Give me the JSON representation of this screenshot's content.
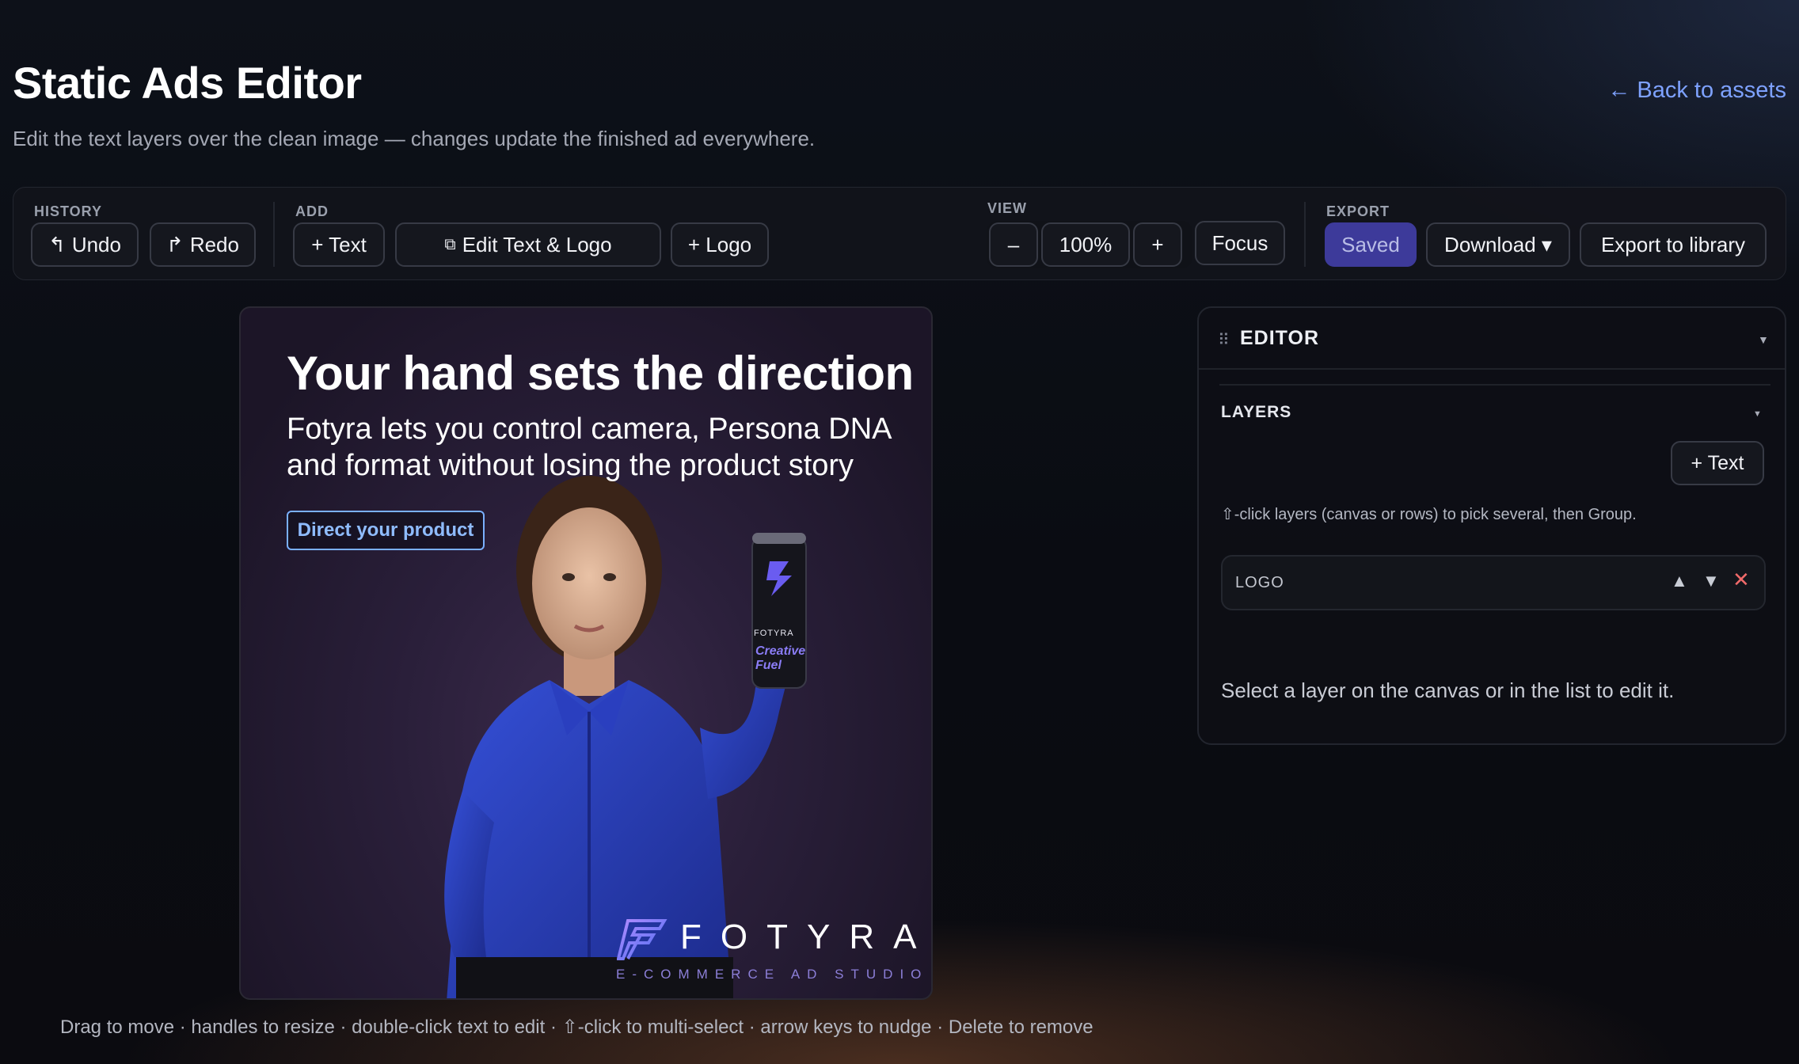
{
  "header": {
    "title": "Static Ads Editor",
    "subtitle": "Edit the text layers over the clean image — changes update the finished ad everywhere.",
    "back_link": "← Back to assets"
  },
  "toolbar": {
    "history": {
      "label": "HISTORY",
      "undo": "Undo",
      "redo": "Redo"
    },
    "add": {
      "label": "ADD",
      "text": "+ Text",
      "edit_text_logo": "Edit Text & Logo",
      "logo": "+ Logo"
    },
    "view": {
      "label": "VIEW",
      "zoom_out": "–",
      "zoom_level": "100%",
      "zoom_in": "+",
      "focus": "Focus"
    },
    "export": {
      "label": "EXPORT",
      "saved": "Saved",
      "download": "Download ▾",
      "export_library": "Export to library"
    }
  },
  "ad": {
    "headline": "Your hand sets the direction",
    "body": "Fotyra lets you control camera, Persona DNA and format without losing the product story",
    "cta": "Direct your product",
    "can_brand": "FOTYRA",
    "can_text": "Creative Fuel",
    "logo_word": "FOTYRA",
    "logo_tagline": "E-COMMERCE AD STUDIO"
  },
  "editor": {
    "title": "EDITOR",
    "layers_title": "LAYERS",
    "add_text": "+ Text",
    "hint": "⇧-click layers (canvas or rows) to pick several, then Group.",
    "layers": [
      {
        "name": "LOGO"
      }
    ],
    "select_message": "Select a layer on the canvas or in the list to edit it."
  },
  "footer_hint": "Drag to move · handles to resize · double-click text to edit · ⇧-click to multi-select · arrow keys to nudge · Delete to remove",
  "colors": {
    "accent": "#7ea2ff",
    "saved_button": "#3d3a9a",
    "cta_border": "#7ab0ff",
    "delete": "#f06a6a",
    "shirt": "#2a3fb3"
  }
}
